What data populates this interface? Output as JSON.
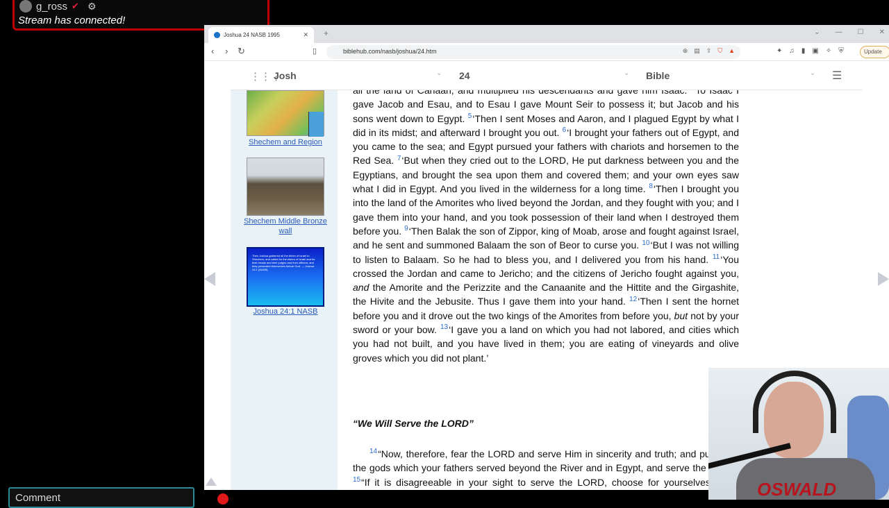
{
  "stream": {
    "username": "g_ross",
    "message": "Stream has connected!",
    "comment_placeholder": "Comment"
  },
  "browser": {
    "tab_title": "Joshua 24 NASB 1995",
    "url": "biblehub.com/nasb/joshua/24.htm",
    "update_label": "Update",
    "brave_count": "9"
  },
  "nav": {
    "book": "Josh",
    "chapter": "24",
    "version": "Bible"
  },
  "sidebar": {
    "captions": [
      "Shechem and Region",
      "Shechem Middle Bronze wall",
      "Joshua 24:1 NASB"
    ],
    "verse_image_text": "Then Joshua gathered all the tribes of Israel to Shechem, and called for the elders of Israel and for their heads and their judges and their officers; and they presented themselves before God. — Joshua 24:1 (NASB)"
  },
  "passage": {
    "line0": "all the land of Canaan, and multiplied his descendants and gave him Isaac.",
    "v4_num": "4",
    "v4": "To Isaac I gave Jacob and Esau, and to Esau I gave Mount Seir to possess it; but Jacob and his sons went down to Egypt.",
    "v5_num": "5",
    "v5": "‘Then I sent Moses and Aaron, and I plagued Egypt by what I did in its midst; and afterward I brought you out.",
    "v6_num": "6",
    "v6": "‘I brought your fathers out of Egypt, and you came to the sea; and Egypt pursued your fathers with chariots and horsemen to the Red Sea.",
    "v7_num": "7",
    "v7": "‘But when they cried out to the LORD, He put darkness between you and the Egyptians, and brought the sea upon them and covered them; and your own eyes saw what I did in Egypt. And you lived in the wilderness for a long time.",
    "v8_num": "8",
    "v8": "‘Then I brought you into the land of the Amorites who lived beyond the Jordan, and they fought with you; and I gave them into your hand, and you took possession of their land when I destroyed them before you.",
    "v9_num": "9",
    "v9": "‘Then Balak the son of Zippor, king of Moab, arose and fought against Israel, and he sent and summoned Balaam the son of Beor to curse you.",
    "v10_num": "10",
    "v10": "‘But I was not willing to listen to Balaam. So he had to bless you, and I delivered you from his hand.",
    "v11_num": "11",
    "v11a": "‘You crossed the Jordan and came to Jericho; and the citizens of Jericho fought against you,",
    "v11_and": "and",
    "v11b": "the Amorite and the Perizzite and the Canaanite and the Hittite and the Girgashite, the Hivite and the Jebusite. Thus I gave them into your hand.",
    "v12_num": "12",
    "v12a": "‘Then I sent the hornet before you and it drove out the two kings of the Amorites from before you,",
    "v12_but": "but",
    "v12b": "not by your sword or your bow.",
    "v13_num": "13",
    "v13": "‘I gave you a land on which you had not labored, and cities which you had not built, and you have lived in them; you are eating of vineyards and olive groves which you did not plant.’",
    "heading": "“We Will Serve the LORD”",
    "v14_num": "14",
    "v14": "“Now, therefore, fear the LORD and serve Him in sincerity and truth; and put away the gods which your fathers served beyond the River and in Egypt, and serve the LORD.",
    "v15_num": "15",
    "v15": "“If it is disagreeable in your sight to serve the LORD, choose for yourselves today whom you will serve"
  },
  "webcam": {
    "shirt_logo": "OSWALD"
  }
}
